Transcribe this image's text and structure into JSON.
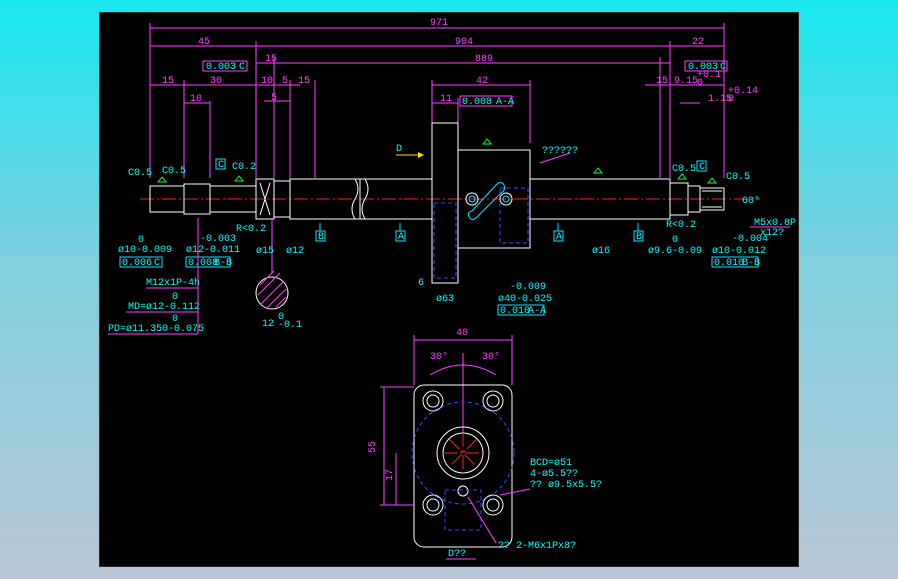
{
  "dims": {
    "overall": "971",
    "d45": "45",
    "d904": "904",
    "d22": "22",
    "d15a": "15",
    "d889": "889",
    "tol_left": "0.003",
    "tol_left_ref": "C",
    "tol_right": "0.003",
    "tol_right_ref": "C",
    "d15b": "15",
    "d30": "30",
    "d10a": "10",
    "d10b": "10",
    "d5a": "5",
    "d15c": "15",
    "d42": "42",
    "d11": "11",
    "tol_nut": "0.008",
    "tol_nut_ref": "A-A",
    "d15d": "15",
    "d9_15": "9.15",
    "d9_15_tol": "+0.1",
    "d9_15_tol2": "0",
    "d1_15": "1.15",
    "d1_15_tol": "+0.14",
    "d1_15_tol2": "0",
    "d5b": "5",
    "d6": "6",
    "d12_tol": "0",
    "d12_tol2": "-0.1",
    "d12": "12"
  },
  "labels": {
    "c05_left": "C0.5",
    "c05_b": "C0.5",
    "c02": "C0.2",
    "c05_r1": "C0.5",
    "c05_r2": "C0.5",
    "d_arrow": "D",
    "qmarks": "??????",
    "r02_left": "R<0.2",
    "r02_right": "R<0.2",
    "angle60": "60°",
    "thread_r": "M5x0.8P",
    "thread_r2": "x12?",
    "phi10_tol1": "0",
    "phi10": "ø10-0.009",
    "phi12_tol1": "-0.003",
    "phi12": "ø12-0.011",
    "phi15": "ø15",
    "phi12b": "ø12",
    "phi16": "ø16",
    "phi9_6_tol1": "0",
    "phi9_6": "ø9.6-0.09",
    "phi10r_tol1": "-0.004",
    "phi10r": "ø10-0.012",
    "phi63": "ø63",
    "phi40_tol1": "-0.009",
    "phi40": "ø40-0.025",
    "tol_phi40": "0.010",
    "tol_phi40_ref": "A-A",
    "tol_shaft_l": "0.006",
    "tol_shaft_l_ref": "C",
    "tol_runout_l": "0.008",
    "tol_runout_l_ref": "B-B",
    "tol_runout_r": "0.010",
    "tol_runout_r_ref": "B-B",
    "m12": "M12x1P-4h",
    "md_tol": "0",
    "md": "MD=ø12-0.112",
    "pd_tol": "0",
    "pd": "PD=ø11.350-0.075",
    "datum_a1": "A",
    "datum_a2": "A",
    "datum_b1": "B",
    "datum_b2": "B",
    "datum_c": "C",
    "datum_c2": "C"
  },
  "flange": {
    "d40": "40",
    "a30l": "30°",
    "a30r": "30°",
    "d55": "55",
    "d17": "17",
    "bcd": "BCD=ø51",
    "holes": "4-ø5.5??",
    "cbore": "?? ø9.5x5.5?",
    "tap": "?? 2-M6x1Px8?",
    "view": "D??"
  }
}
